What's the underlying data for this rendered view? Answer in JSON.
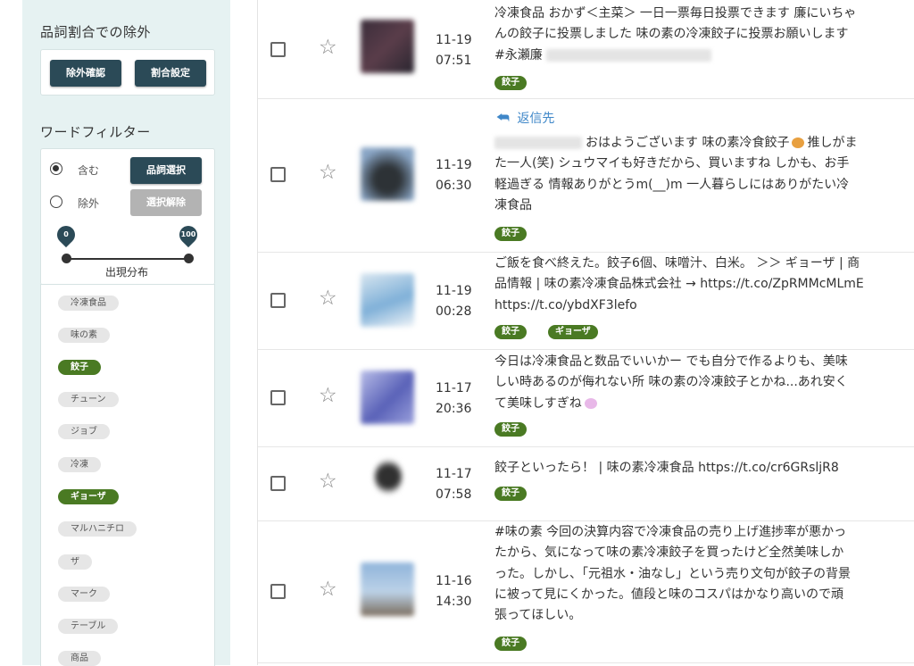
{
  "filters": {
    "pos_exclusion": {
      "title": "品詞割合での除外",
      "confirm_btn": "除外確認",
      "settings_btn": "割合設定"
    },
    "word_filter": {
      "title": "ワードフィルター",
      "include_label": "含む",
      "exclude_label": "除外",
      "pos_select_btn": "品詞選択",
      "clear_select_btn": "選択解除",
      "slider_min": "0",
      "slider_max": "100",
      "slider_caption": "出現分布",
      "words": [
        {
          "label": "冷凍食品",
          "selected": false
        },
        {
          "label": "味の素",
          "selected": false
        },
        {
          "label": "餃子",
          "selected": true
        },
        {
          "label": "チューン",
          "selected": false
        },
        {
          "label": "ジョブ",
          "selected": false
        },
        {
          "label": "冷凍",
          "selected": false
        },
        {
          "label": "ギョーザ",
          "selected": true
        },
        {
          "label": "マルハニチロ",
          "selected": false
        },
        {
          "label": "ザ",
          "selected": false
        },
        {
          "label": "マーク",
          "selected": false
        },
        {
          "label": "テーブル",
          "selected": false
        },
        {
          "label": "商品",
          "selected": false
        }
      ]
    }
  },
  "posts": [
    {
      "date": "11-19",
      "time": "07:51",
      "lines": [
        "冷凍食品 おかず＜主菜＞ 一日一票毎日投票できます 廉にいちゃ",
        "んの餃子に投票しました 味の素の冷凍餃子に投票お願いします",
        "#永瀬廉"
      ],
      "tags": [
        "餃子"
      ]
    },
    {
      "date": "11-19",
      "time": "06:30",
      "reply_label": "返信先",
      "lines": [
        "おはようございます 味の素冷食餃子",
        "推しがま",
        "た一人(笑) シュウマイも好きだから、買いますね しかも、お手",
        "軽過ぎる 情報ありがとうm(__)m 一人暮らしにはありがたい冷",
        "凍食品"
      ],
      "tags": [
        "餃子"
      ]
    },
    {
      "date": "11-19",
      "time": "00:28",
      "lines": [
        "ご飯を食べ終えた。餃子6個、味噌汁、白米。 ＞＞ ギョーザ | 商",
        "品情報 | 味の素冷凍食品株式会社 → https://t.co/ZpRMMcMLmE",
        "https://t.co/ybdXF3lefo"
      ],
      "tags": [
        "餃子",
        "ギョーザ"
      ]
    },
    {
      "date": "11-17",
      "time": "20:36",
      "lines": [
        "今日は冷凍食品と数品でいいかー でも自分で作るよりも、美味",
        "しい時あるのが侮れない所 味の素の冷凍餃子とかね...あれ安く",
        "て美味しすぎね"
      ],
      "tags": [
        "餃子"
      ]
    },
    {
      "date": "11-17",
      "time": "07:58",
      "lines": [
        "餃子といったら！ | 味の素冷凍食品 https://t.co/cr6GRsljR8"
      ],
      "tags": [
        "餃子"
      ]
    },
    {
      "date": "11-16",
      "time": "14:30",
      "lines": [
        "#味の素 今回の決算内容で冷凍食品の売り上げ進捗率が悪かっ",
        "たから、気になって味の素冷凍餃子を買ったけど全然美味しか",
        "った。しかし、「元祖水・油なし」という売り文句が餃子の背景",
        "に被って見にくかった。値段と味のコスパはかなり高いので頑",
        "張ってほしい。"
      ],
      "tags": [
        "餃子"
      ]
    }
  ],
  "colors": {
    "dark_button": "#2b4a57",
    "tag_green": "#4a7a23",
    "panel_bg": "#e6f2f2",
    "reply_blue": "#3f87c8"
  }
}
